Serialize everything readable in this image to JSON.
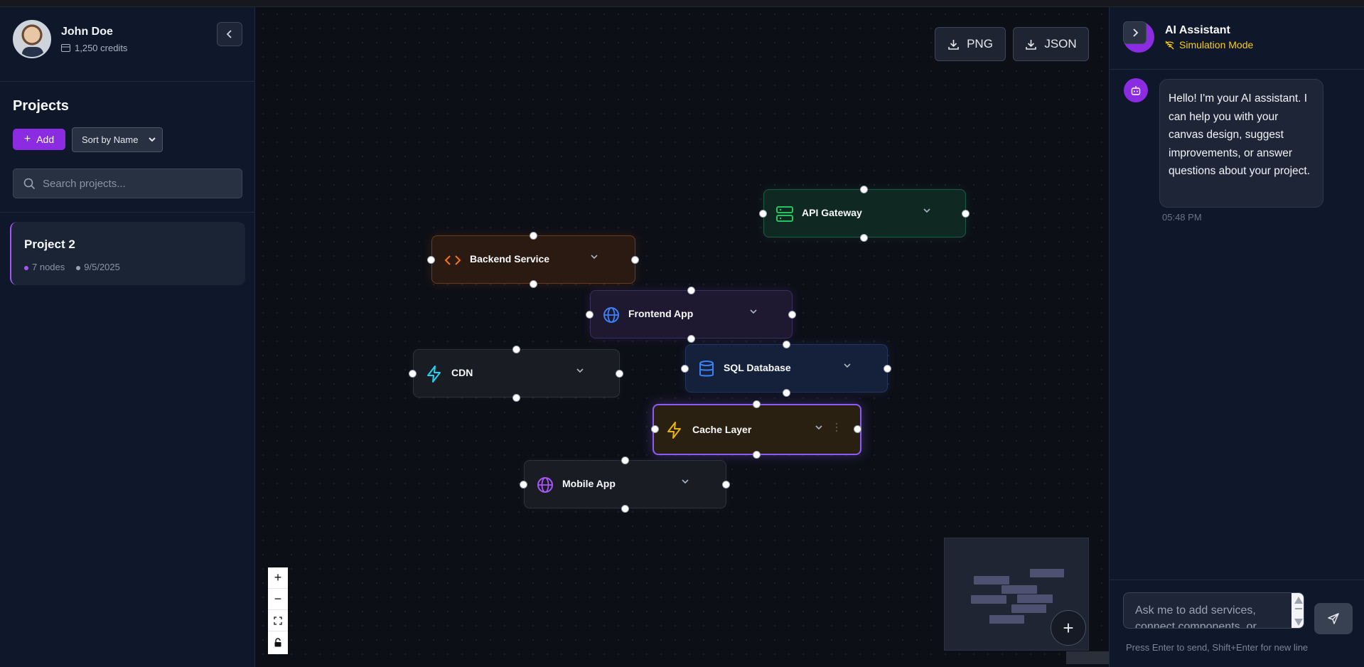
{
  "user": {
    "name": "John Doe",
    "credits": "1,250 credits"
  },
  "sidebar": {
    "projects_title": "Projects",
    "add_label": "Add",
    "sort_label": "Sort by Name",
    "search_placeholder": "Search projects...",
    "projects": [
      {
        "name": "Project 2",
        "nodes": "7 nodes",
        "date": "9/5/2025"
      }
    ]
  },
  "toolbar": {
    "png_label": "PNG",
    "json_label": "JSON"
  },
  "canvas": {
    "nodes": [
      {
        "label": "API Gateway",
        "icon": "server-icon",
        "accent": "#22c55e"
      },
      {
        "label": "Backend Service",
        "icon": "code-icon",
        "accent": "#f97316"
      },
      {
        "label": "Frontend App",
        "icon": "globe-icon",
        "accent": "#3b82f6"
      },
      {
        "label": "CDN",
        "icon": "zap-icon",
        "accent": "#22d3ee"
      },
      {
        "label": "SQL Database",
        "icon": "database-icon",
        "accent": "#3b82f6"
      },
      {
        "label": "Cache Layer",
        "icon": "zap-icon",
        "accent": "#eab308"
      },
      {
        "label": "Mobile App",
        "icon": "globe-icon",
        "accent": "#a855f7"
      }
    ],
    "zoom_controls": [
      "+",
      "−",
      "fit-view-icon",
      "lock-icon"
    ]
  },
  "assistant": {
    "title": "AI Assistant",
    "mode": "Simulation Mode",
    "message": "Hello! I'm your AI assistant. I can help you with your canvas design, suggest improvements, or answer questions about your project.",
    "time": "05:48 PM",
    "input_placeholder": "Ask me to add services, connect components, or",
    "hint": "Press Enter to send, Shift+Enter for new line"
  },
  "colors": {
    "accent": "#8b2be2",
    "warning": "#facc15"
  }
}
